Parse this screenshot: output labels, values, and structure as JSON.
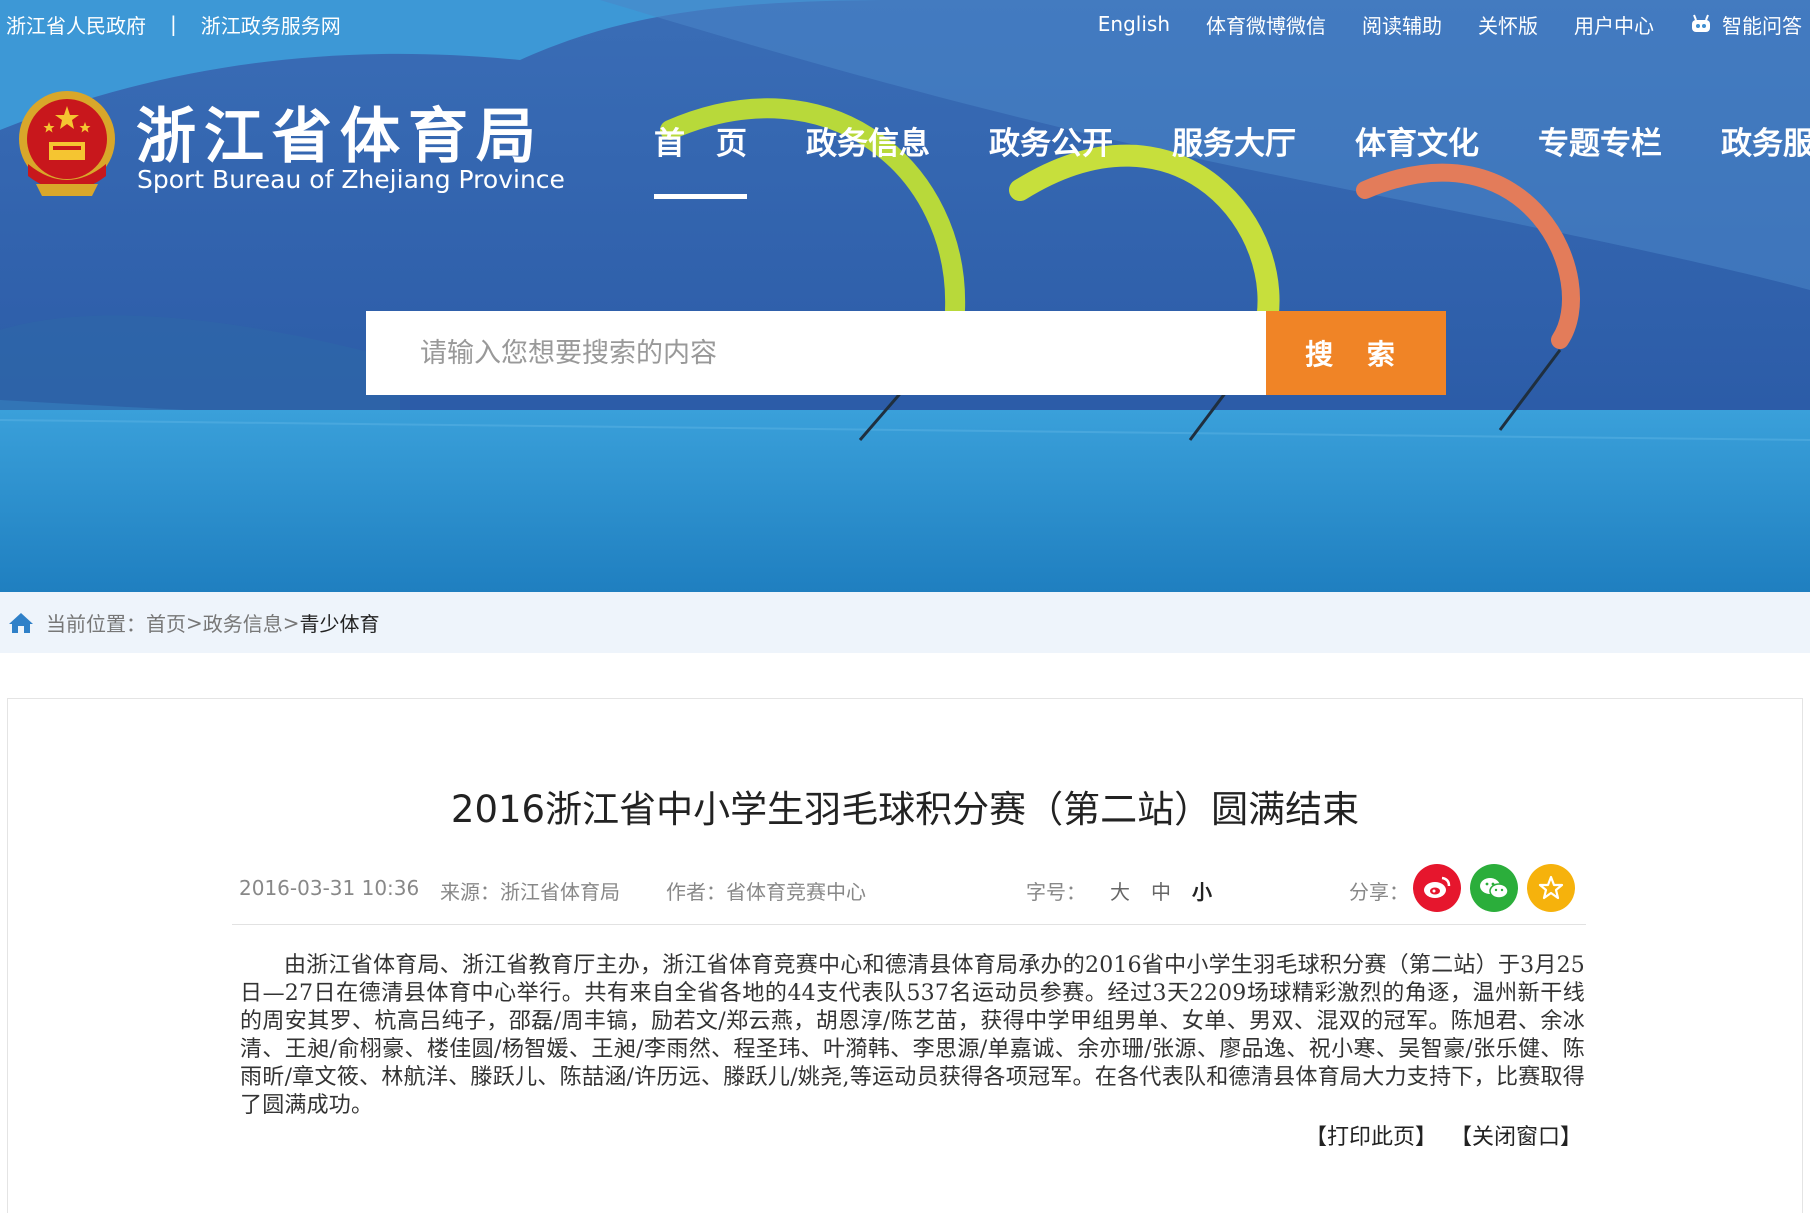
{
  "header": {
    "top_links": [
      "浙江省人民政府",
      "浙江政务服务网"
    ],
    "top_links_sep": "|",
    "util_links": [
      "English",
      "体育微博微信",
      "阅读辅助",
      "关怀版",
      "用户中心",
      "智能问答"
    ],
    "logo_cn": "浙江省体育局",
    "logo_en": "Sport Bureau of Zhejiang Province",
    "nav": [
      "首　页",
      "政务信息",
      "政务公开",
      "服务大厅",
      "体育文化",
      "专题专栏",
      "政务服务"
    ],
    "active_nav": "首　页"
  },
  "search": {
    "placeholder": "请输入您想要搜索的内容",
    "button_label": "搜 索"
  },
  "breadcrumb": {
    "prefix": "当前位置：",
    "items": [
      "首页",
      "政务信息",
      "青少体育"
    ],
    "sep": ">"
  },
  "article": {
    "title": "2016浙江省中小学生羽毛球积分赛（第二站）圆满结束",
    "date": "2016-03-31 10:36",
    "source": "来源：浙江省体育局",
    "author": "作者：省体育竞赛中心",
    "font_size_label": "字号：",
    "font_sizes": [
      "大",
      "中",
      "小"
    ],
    "share_label": "分享：",
    "body": "由浙江省体育局、浙江省教育厅主办，浙江省体育竞赛中心和德清县体育局承办的2016省中小学生羽毛球积分赛（第二站）于3月25日—27日在德清县体育中心举行。共有来自全省各地的44支代表队537名运动员参赛。经过3天2209场球精彩激烈的角逐，温州新干线的周安其罗、杭高吕纯子，邵磊/周丰镐，励若文/郑云燕，胡恩淳/陈艺苗，获得中学甲组男单、女单、男双、混双的冠军。陈旭君、余冰清、王昶/俞栩豪、楼佳圆/杨智媛、王昶/李雨然、程圣玮、叶漪韩、李思源/单嘉诚、余亦珊/张源、廖品逸、祝小寒、吴智豪/张乐健、陈雨昕/章文筱、林航洋、滕跃儿、陈喆涵/许历远、滕跃儿/姚尧,等运动员获得各项冠军。在各代表队和德清县体育局大力支持下，比赛取得了圆满成功。",
    "print_label": "【打印此页】",
    "close_label": "【关闭窗口】"
  },
  "colors": {
    "search_button": "#f08426",
    "crumb_bg": "#eef4fb",
    "weibo": "#e6162d",
    "wechat": "#2bae3b",
    "favorite": "#f6b20c"
  }
}
